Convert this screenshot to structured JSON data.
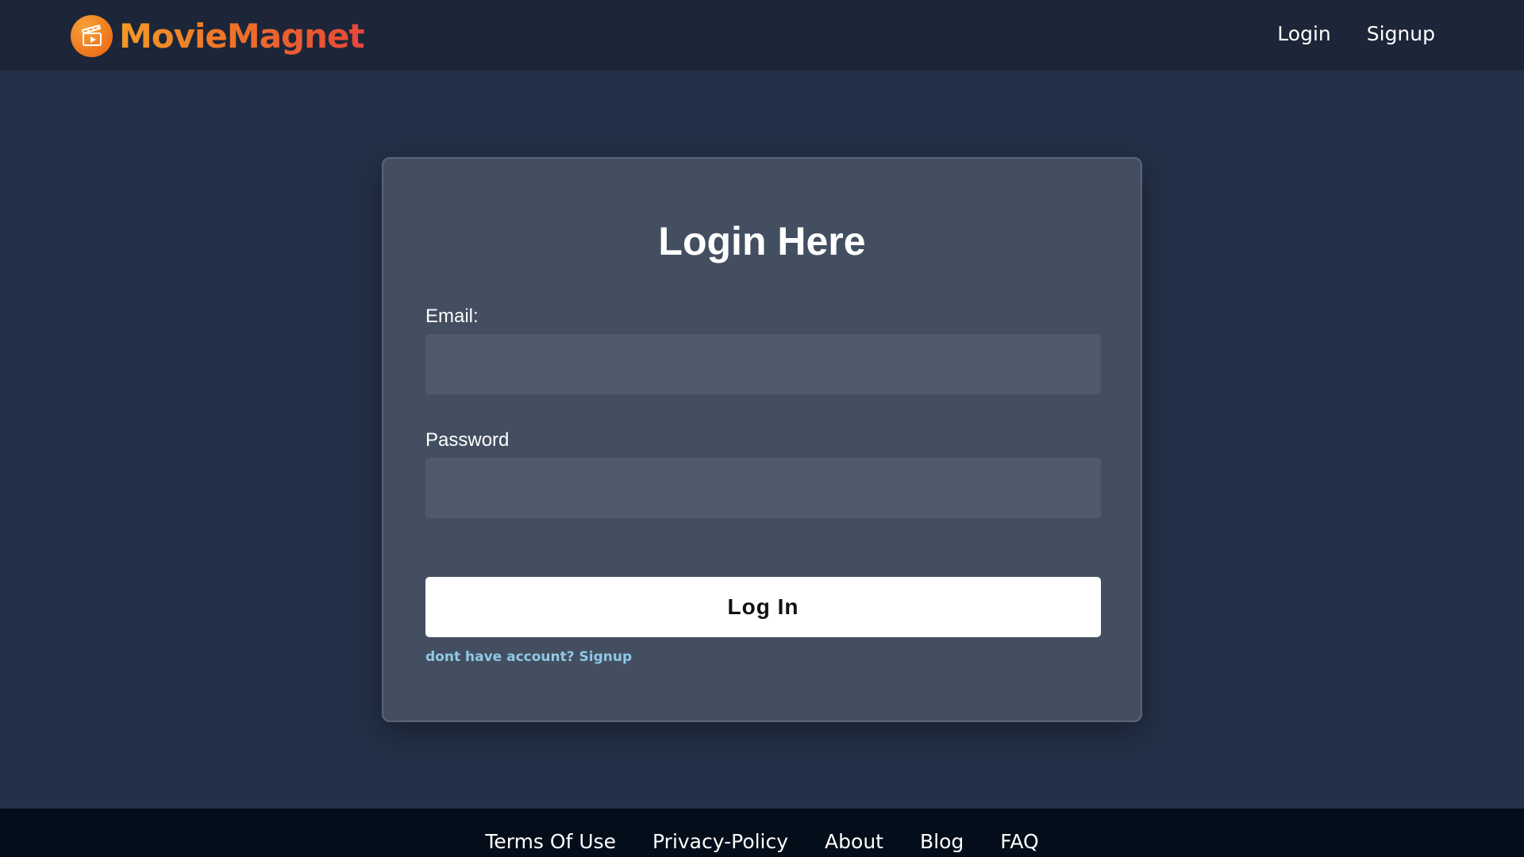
{
  "brand": {
    "name": "MovieMagnet",
    "logo_icon": "clapperboard-play-icon",
    "colors": {
      "logo_start": "#f39a25",
      "logo_end": "#e6463a"
    }
  },
  "nav": {
    "login": "Login",
    "signup": "Signup"
  },
  "form": {
    "title": "Login Here",
    "email_label": "Email:",
    "email_value": "",
    "password_label": "Password",
    "password_value": "",
    "submit_label": "Log In",
    "signup_prompt": "dont have account?",
    "signup_link": "Signup"
  },
  "footer": {
    "links": [
      "Terms Of Use",
      "Privacy-Policy",
      "About",
      "Blog",
      "FAQ"
    ]
  },
  "colors": {
    "page_bg": "#233047",
    "header_bg": "#1c2638",
    "card_bg": "#434f60",
    "input_bg": "#4f5a6a",
    "footer_bg": "#040d1a",
    "link_accent": "#8fc8e6"
  }
}
